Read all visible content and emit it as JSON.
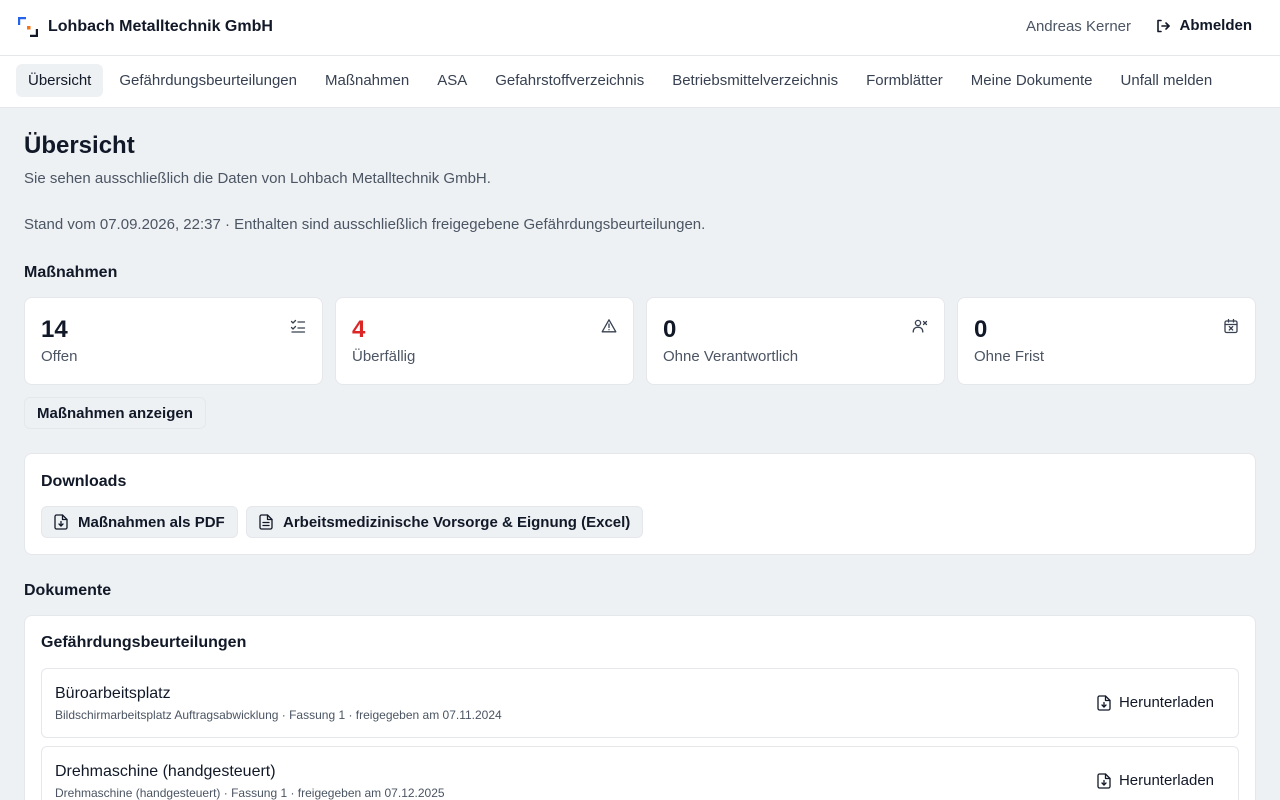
{
  "header": {
    "brand_name": "Lohbach Metalltechnik GmbH",
    "brand_logo_icon": "bracket-logo-icon",
    "user_name": "Andreas Kerner",
    "logout_label": "Abmelden",
    "logout_icon": "logout-icon"
  },
  "nav": {
    "items": [
      {
        "label": "Übersicht",
        "active": true
      },
      {
        "label": "Gefährdungsbeurteilungen",
        "active": false
      },
      {
        "label": "Maßnahmen",
        "active": false
      },
      {
        "label": "ASA",
        "active": false
      },
      {
        "label": "Gefahrstoffverzeichnis",
        "active": false
      },
      {
        "label": "Betriebsmittelverzeichnis",
        "active": false
      },
      {
        "label": "Formblätter",
        "active": false
      },
      {
        "label": "Meine Dokumente",
        "active": false
      },
      {
        "label": "Unfall melden",
        "active": false
      }
    ]
  },
  "page": {
    "title": "Übersicht",
    "subtitle": "Sie sehen ausschließlich die Daten von Lohbach Metalltechnik GmbH.",
    "stand": "Stand vom 07.09.2026, 22:37 · Enthalten sind ausschließlich freigegebene Gefährdungsbeurteilungen."
  },
  "massnahmen": {
    "section_title": "Maßnahmen",
    "stats": [
      {
        "value": "14",
        "label": "Offen",
        "icon": "checklist-icon",
        "alert": false
      },
      {
        "value": "4",
        "label": "Überfällig",
        "icon": "warning-triangle-icon",
        "alert": true
      },
      {
        "value": "0",
        "label": "Ohne Verantwortlich",
        "icon": "user-x-icon",
        "alert": false
      },
      {
        "value": "0",
        "label": "Ohne Frist",
        "icon": "calendar-x-icon",
        "alert": false
      }
    ],
    "show_button": "Maßnahmen anzeigen"
  },
  "downloads": {
    "title": "Downloads",
    "buttons": [
      {
        "label": "Maßnahmen als PDF",
        "icon": "file-download-icon"
      },
      {
        "label": "Arbeitsmedizinische Vorsorge & Eignung (Excel)",
        "icon": "file-text-icon"
      }
    ]
  },
  "dokumente": {
    "section_title": "Dokumente",
    "panel_title": "Gefährdungsbeurteilungen",
    "items": [
      {
        "title": "Büroarbeitsplatz",
        "meta": "Bildschirmarbeitsplatz Auftragsabwicklung · Fassung 1 · freigegeben am 07.11.2024",
        "download_label": "Herunterladen"
      },
      {
        "title": "Drehmaschine (handgesteuert)",
        "meta": "Drehmaschine (handgesteuert) · Fassung 1 · freigegeben am 07.12.2025",
        "download_label": "Herunterladen"
      }
    ]
  },
  "colors": {
    "accent_blue": "#2563eb",
    "accent_orange": "#f97316",
    "danger": "#dc2626",
    "background": "#eef1f4"
  }
}
